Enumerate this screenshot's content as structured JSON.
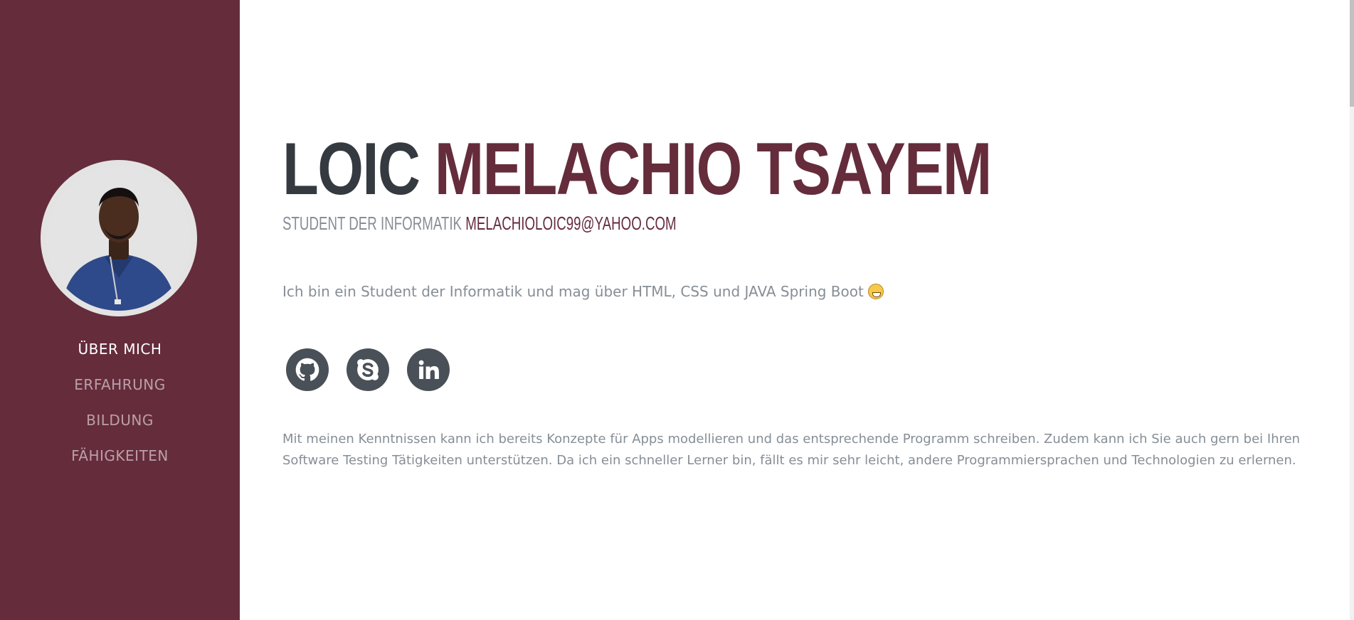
{
  "sidebar": {
    "avatar_alt": "profile photo",
    "nav": [
      {
        "label": "ÜBER MICH",
        "active": true
      },
      {
        "label": "ERFAHRUNG",
        "active": false
      },
      {
        "label": "BILDUNG",
        "active": false
      },
      {
        "label": "FÄHIGKEITEN",
        "active": false
      }
    ]
  },
  "main": {
    "first_name": "LOIC",
    "last_name": "MELACHIO TSAYEM",
    "subheading": "STUDENT DER INFORMATIK",
    "email": "MELACHIOLOIC99@YAHOO.COM",
    "lead": "Ich bin ein Student der Informatik und mag über HTML, CSS und JAVA Spring Boot",
    "social": [
      {
        "name": "github-icon"
      },
      {
        "name": "skype-icon"
      },
      {
        "name": "linkedin-icon"
      }
    ],
    "body": "Mit meinen Kenntnissen kann ich bereits Konzepte für Apps modellieren und das entsprechende Programm schreiben. Zudem kann ich Sie auch gern bei Ihren Software Testing Tätigkeiten unterstützen. Da ich ein schneller Lerner bin, fällt es mir sehr leicht, andere Programmiersprachen und Technologien zu erlernen."
  },
  "colors": {
    "primary": "#652c3c",
    "dark": "#343a40",
    "muted": "#868e96",
    "icon_bg": "#495057"
  }
}
